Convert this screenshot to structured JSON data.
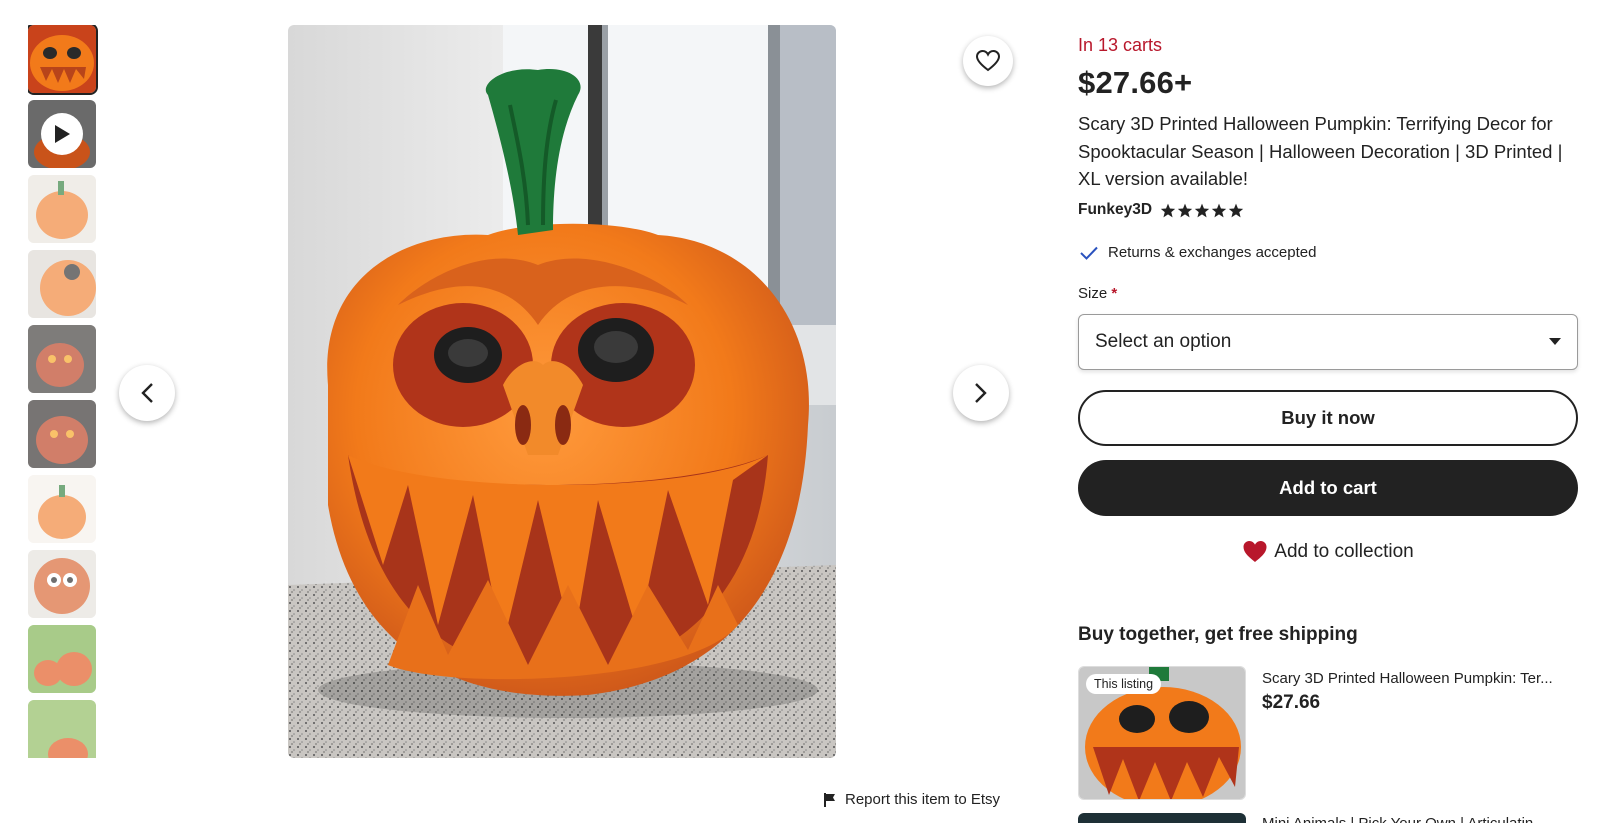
{
  "gallery": {
    "thumbnails": [
      {
        "kind": "image",
        "active": true
      },
      {
        "kind": "video"
      },
      {
        "kind": "image"
      },
      {
        "kind": "image"
      },
      {
        "kind": "image"
      },
      {
        "kind": "image"
      },
      {
        "kind": "image"
      },
      {
        "kind": "image"
      },
      {
        "kind": "image"
      },
      {
        "kind": "image"
      }
    ],
    "report_label": "Report this item to Etsy"
  },
  "listing": {
    "carts_text": "In 13 carts",
    "price": "$27.66+",
    "title": "Scary 3D Printed Halloween Pumpkin: Terrifying Decor for Spooktacular Season | Halloween Decoration | 3D Printed | XL version available!",
    "seller": "Funkey3D",
    "rating_stars": 5,
    "returns_text": "Returns & exchanges accepted",
    "size_label": "Size",
    "size_required_mark": "*",
    "size_select_value": "Select an option",
    "buy_now_label": "Buy it now",
    "add_to_cart_label": "Add to cart",
    "add_to_collection_label": "Add to collection"
  },
  "bundle": {
    "heading": "Buy together, get free shipping",
    "items": [
      {
        "tag": "This listing",
        "title": "Scary 3D Printed Halloween Pumpkin: Ter...",
        "price": "$27.66"
      },
      {
        "title": "Mini Animals | Pick Your Own | Articulatin..."
      }
    ]
  },
  "colors": {
    "accent_red": "#b8172b",
    "dark_button": "#222222",
    "check_blue": "#2a52be",
    "pumpkin_orange": "#f27a1a",
    "stem_green": "#1f7a3a"
  },
  "icons": [
    "play-icon",
    "heart-outline-icon",
    "chevron-left-icon",
    "chevron-right-icon",
    "flag-icon",
    "star-icon",
    "check-icon",
    "caret-down-icon",
    "heart-filled-icon"
  ]
}
